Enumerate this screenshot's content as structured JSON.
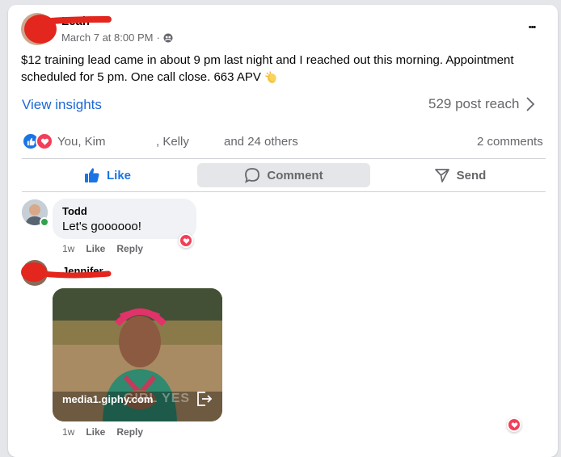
{
  "post": {
    "author_name": "Leah",
    "timestamp": "March 7 at 8:00 PM",
    "separator": "·",
    "more_label": "•••",
    "text_line1": "$12 training lead came in about 9 pm last night and I reached out this morning. Appointment",
    "text_line2": "scheduled for 5 pm. One call close. 663 APV",
    "insights_label": "View insights",
    "reach_label": "529 post reach",
    "reactions": {
      "name1": "You, Kim",
      "name2": ", Kelly",
      "others": "and 24 others"
    },
    "comments_count": "2 comments",
    "actions": {
      "like": "Like",
      "comment": "Comment",
      "send": "Send"
    }
  },
  "comments": [
    {
      "author": "Todd",
      "text": "Let's goooooo!",
      "age": "1w",
      "like": "Like",
      "reply": "Reply"
    },
    {
      "author": "Jennifer",
      "gif_source": "media1.giphy.com",
      "gif_caption": "GIRL YES",
      "age": "1w",
      "like": "Like",
      "reply": "Reply"
    }
  ],
  "colors": {
    "accent": "#1d67d6",
    "heart": "#f33e58",
    "redaction": "#e3261e"
  }
}
